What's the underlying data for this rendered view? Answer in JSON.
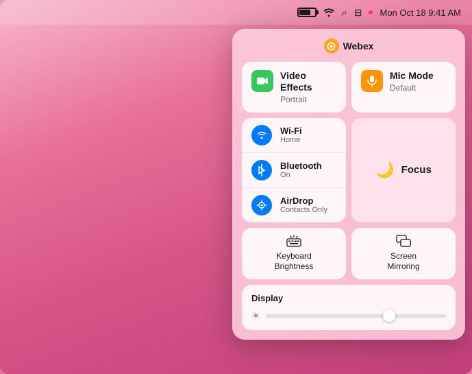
{
  "desktop": {
    "bg_color": "#e87099"
  },
  "menu_bar": {
    "time": "Mon Oct 18  9:41 AM",
    "battery_label": "battery",
    "wifi_label": "wifi",
    "search_label": "search",
    "screens_label": "screens"
  },
  "control_center": {
    "webex_header": "Webex",
    "video_effects": {
      "title": "Video Effects",
      "subtitle": "Portrait"
    },
    "mic_mode": {
      "title": "Mic Mode",
      "subtitle": "Default"
    },
    "wifi": {
      "title": "Wi-Fi",
      "subtitle": "Home"
    },
    "bluetooth": {
      "title": "Bluetooth",
      "subtitle": "On"
    },
    "airdrop": {
      "title": "AirDrop",
      "subtitle": "Contacts Only"
    },
    "focus": {
      "label": "Focus"
    },
    "keyboard_brightness": {
      "line1": "Keyboard",
      "line2": "Brightness"
    },
    "screen_mirroring": {
      "line1": "Screen",
      "line2": "Mirroring"
    },
    "display": {
      "label": "Display",
      "slider_value": 70
    }
  }
}
